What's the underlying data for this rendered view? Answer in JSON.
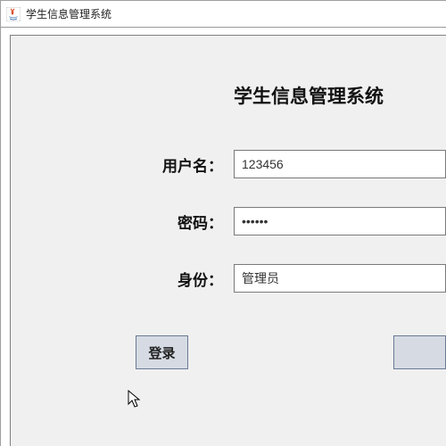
{
  "window": {
    "title": "学生信息管理系统"
  },
  "heading": "学生信息管理系统",
  "form": {
    "username_label": "用户名：",
    "username_value": "123456",
    "password_label": "密码：",
    "password_value": "******",
    "role_label": "身份：",
    "role_value": "管理员"
  },
  "buttons": {
    "login": "登录"
  },
  "icons": {
    "app": "java-app-icon",
    "cursor": "mouse-cursor-icon"
  }
}
